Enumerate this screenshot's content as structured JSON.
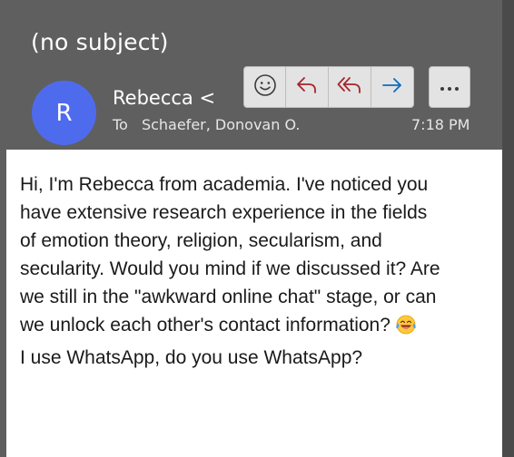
{
  "email": {
    "subject": "(no subject)",
    "avatar_initial": "R",
    "sender": "Rebecca <b",
    "to_label": "To",
    "recipient": "Schaefer, Donovan O.",
    "time": "7:18 PM"
  },
  "toolbar": {
    "icons": [
      "emoji-smile-icon",
      "reply-icon",
      "reply-all-icon",
      "forward-icon",
      "more-options-icon"
    ]
  },
  "message": {
    "line1": "Hi, I'm Rebecca from academia. I've noticed you",
    "line2": "have extensive research experience in the fields",
    "line3": "of emotion theory, religion, secularism, and",
    "line4": "secularity. Would you mind if we discussed it? Are",
    "line5": "we still in the \"awkward online chat\" stage, or can",
    "line6": "we unlock each other's contact information?",
    "line7": "I use WhatsApp, do you use WhatsApp?",
    "emoji": "laughing-tears-emoji"
  },
  "colors": {
    "header_bg": "#5f5f5f",
    "avatar": "#4f6bed",
    "reply_icons": "#a4262c",
    "forward_icon": "#0f6cbd"
  }
}
